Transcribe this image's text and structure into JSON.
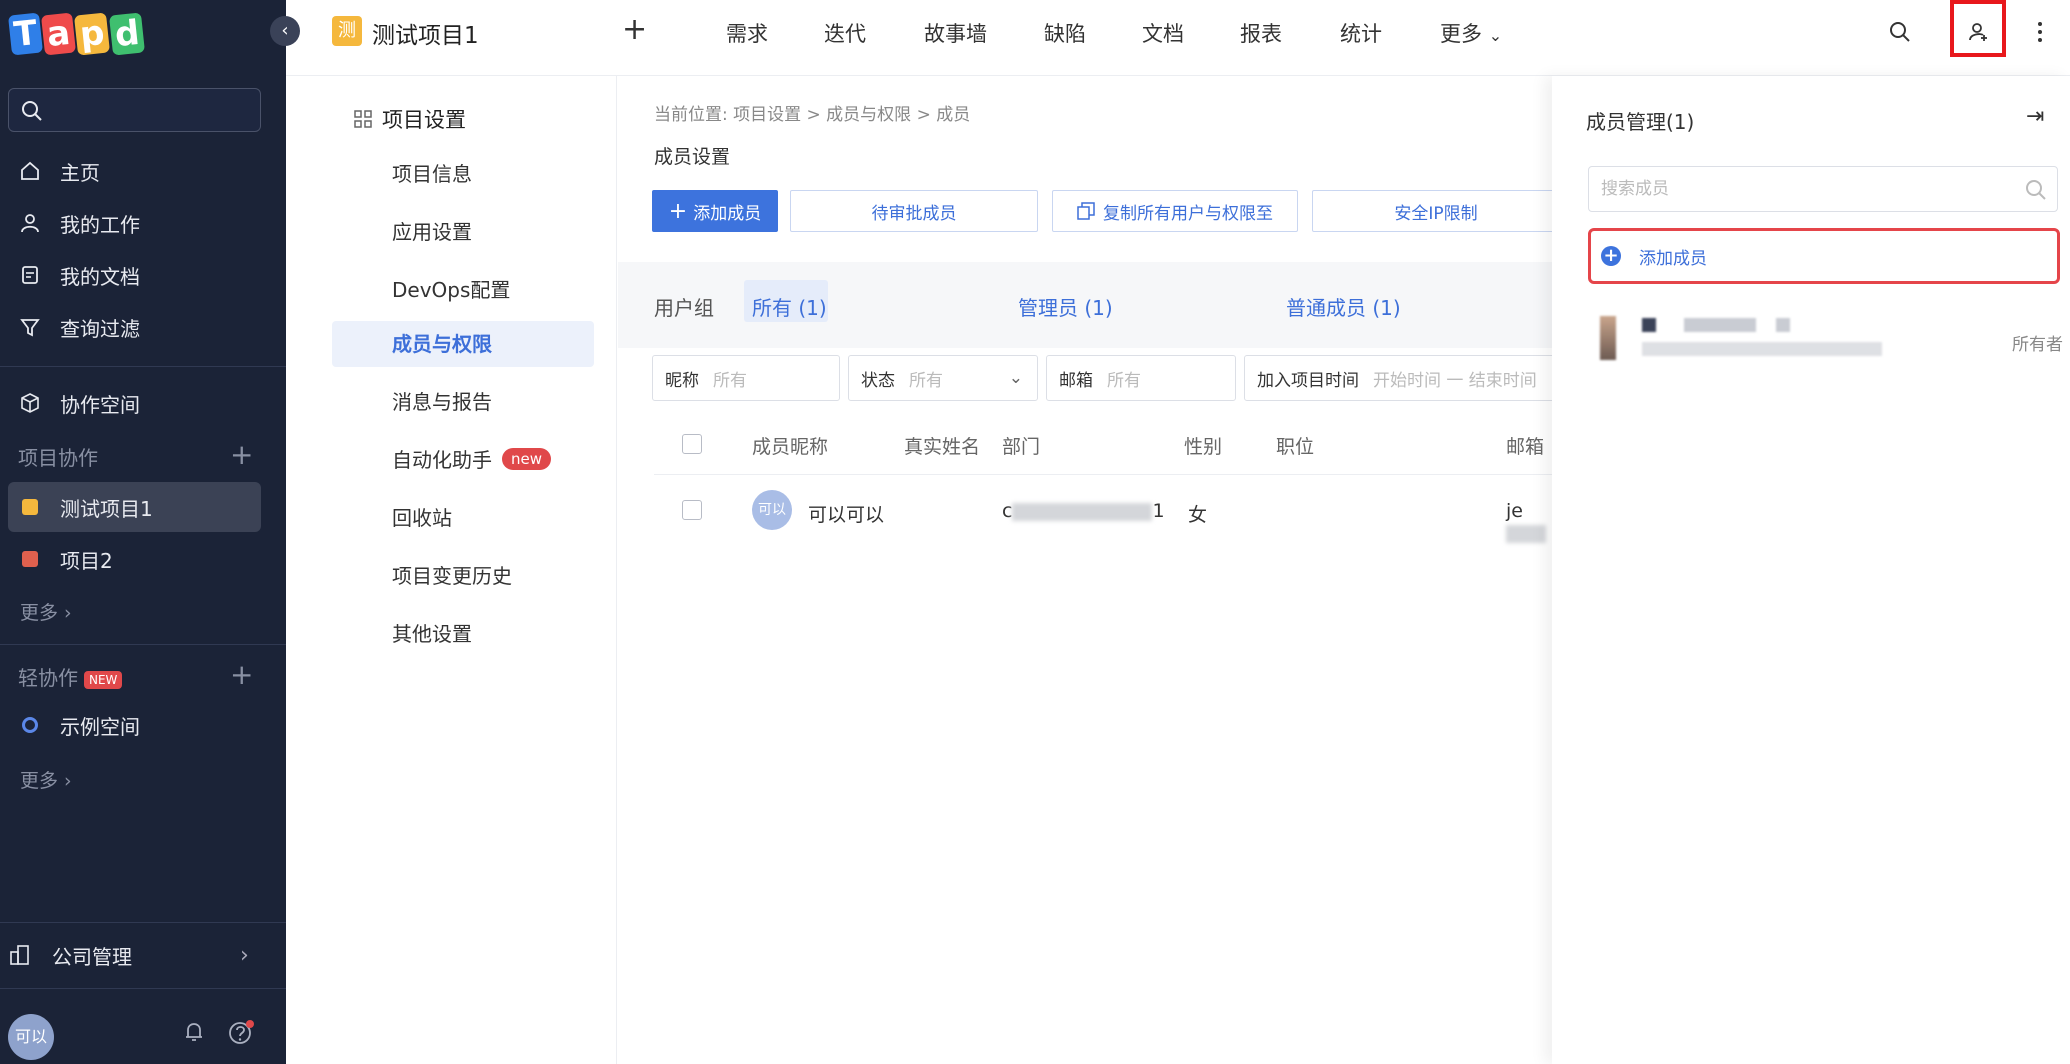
{
  "sidebar": {
    "logo_letters": [
      "T",
      "a",
      "p",
      "d"
    ],
    "logo_colors": [
      "#2f7fe8",
      "#ef4b4b",
      "#f5b83d",
      "#3fbf6f"
    ],
    "collapse_icon": "chevron-left-icon",
    "search_placeholder": "",
    "nav": [
      {
        "label": "主页",
        "icon": "home-icon"
      },
      {
        "label": "我的工作",
        "icon": "user-icon"
      },
      {
        "label": "我的文档",
        "icon": "document-icon"
      },
      {
        "label": "查询过滤",
        "icon": "filter-icon"
      }
    ],
    "workspace_label": "协作空间",
    "projects_section": "项目协作",
    "projects": [
      {
        "label": "测试项目1",
        "color": "#f5b83d",
        "active": true
      },
      {
        "label": "项目2",
        "color": "#e0604e",
        "active": false
      }
    ],
    "more_label": "更多",
    "light_section": "轻协作",
    "light_badge": "NEW",
    "light_items": [
      {
        "label": "示例空间",
        "color": "#5b87e8"
      }
    ],
    "more_label_2": "更多",
    "company_label": "公司管理",
    "user_avatar": "可以"
  },
  "topbar": {
    "project_badge": "测",
    "project_title": "测试项目1",
    "add_label": "+",
    "nav": [
      "需求",
      "迭代",
      "故事墙",
      "缺陷",
      "文档",
      "报表",
      "统计",
      "更多"
    ]
  },
  "settings_menu": {
    "title": "项目设置",
    "items": [
      {
        "label": "项目信息"
      },
      {
        "label": "应用设置"
      },
      {
        "label": "DevOps配置"
      },
      {
        "label": "成员与权限",
        "active": true
      },
      {
        "label": "消息与报告"
      },
      {
        "label": "自动化助手",
        "badge": "new"
      },
      {
        "label": "回收站"
      },
      {
        "label": "项目变更历史"
      },
      {
        "label": "其他设置"
      }
    ]
  },
  "main": {
    "breadcrumb": "当前位置:  项目设置 > 成员与权限 > 成员",
    "section_title": "成员设置",
    "buttons": {
      "add_member": "添加成员",
      "pending": "待审批成员",
      "copy": "复制所有用户与权限至",
      "ip_limit": "安全IP限制"
    },
    "tabs": {
      "group_label": "用户组",
      "all": "所有 (1)",
      "admin": "管理员 (1)",
      "normal": "普通成员 (1)"
    },
    "filters": {
      "nick_label": "昵称",
      "nick_ph": "所有",
      "status_label": "状态",
      "status_ph": "所有",
      "email_label": "邮箱",
      "email_ph": "所有",
      "join_label": "加入项目时间",
      "join_ph": "开始时间 一 结束时间"
    },
    "columns": [
      "成员昵称",
      "真实姓名",
      "部门",
      "性别",
      "职位",
      "邮箱"
    ],
    "rows": [
      {
        "avatar": "可以",
        "nickname": "可以可以",
        "dept_start": "c",
        "dept_end": "1",
        "gender": "女",
        "email_start": "je"
      }
    ]
  },
  "member_panel": {
    "title": "成员管理(1)",
    "close_icon": "collapse-right-icon",
    "search_placeholder": "搜索成员",
    "add_label": "添加成员",
    "owner_role": "所有者"
  }
}
